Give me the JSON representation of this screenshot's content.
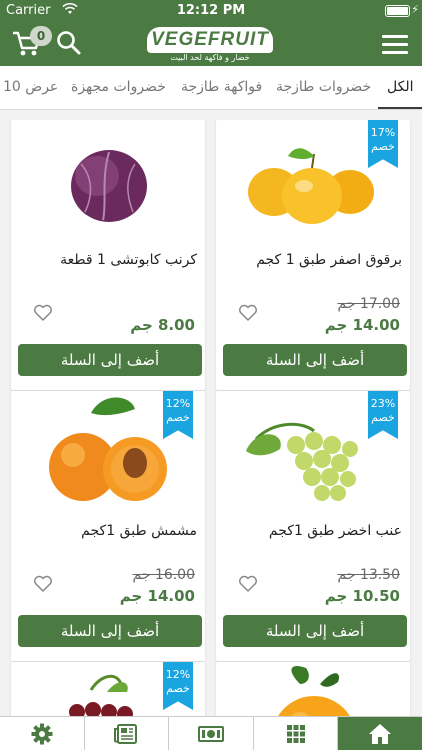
{
  "status": {
    "carrier": "Carrier",
    "time": "12:12 PM"
  },
  "header": {
    "cart_count": "0",
    "logo_text": "VEGEFRUIT",
    "logo_tagline": "خضار و فاكهة لحد البيت"
  },
  "tabs": [
    {
      "label": "الكل",
      "active": true
    },
    {
      "label": "خضروات طازجة"
    },
    {
      "label": "فواكهة طازجة"
    },
    {
      "label": "خضروات مجهزة"
    },
    {
      "label": "عرض 10"
    }
  ],
  "products": [
    {
      "name": "برقوق اصفر طبق 1 كجم",
      "old_price": "17.00 جم",
      "price": "14.00 جم",
      "discount": "17% خصم",
      "image": "yellow-plums",
      "add_label": "أضف إلى السلة"
    },
    {
      "name": "كرنب كابوتشى 1 قطعة",
      "old_price": "",
      "price": "8.00 جم",
      "discount": "",
      "image": "red-cabbage",
      "add_label": "أضف إلى السلة"
    },
    {
      "name": "عنب اخضر طبق 1كجم",
      "old_price": "13.50 جم",
      "price": "10.50 جم",
      "discount": "23% خصم",
      "image": "green-grapes",
      "add_label": "أضف إلى السلة"
    },
    {
      "name": "مشمش طبق 1كجم",
      "old_price": "16.00 جم",
      "price": "14.00 جم",
      "discount": "12% خصم",
      "image": "apricots",
      "add_label": "أضف إلى السلة"
    },
    {
      "name": "",
      "old_price": "",
      "price": "",
      "discount": "",
      "image": "orange",
      "add_label": ""
    },
    {
      "name": "",
      "old_price": "",
      "price": "",
      "discount": "12% خصم",
      "image": "red-grapes",
      "add_label": ""
    }
  ],
  "bottom_nav": [
    "home-icon",
    "grid-icon",
    "money-icon",
    "news-icon",
    "gear-icon"
  ],
  "colors": {
    "brand_green": "#4c7a43",
    "discount_blue": "#1aa5e0"
  }
}
